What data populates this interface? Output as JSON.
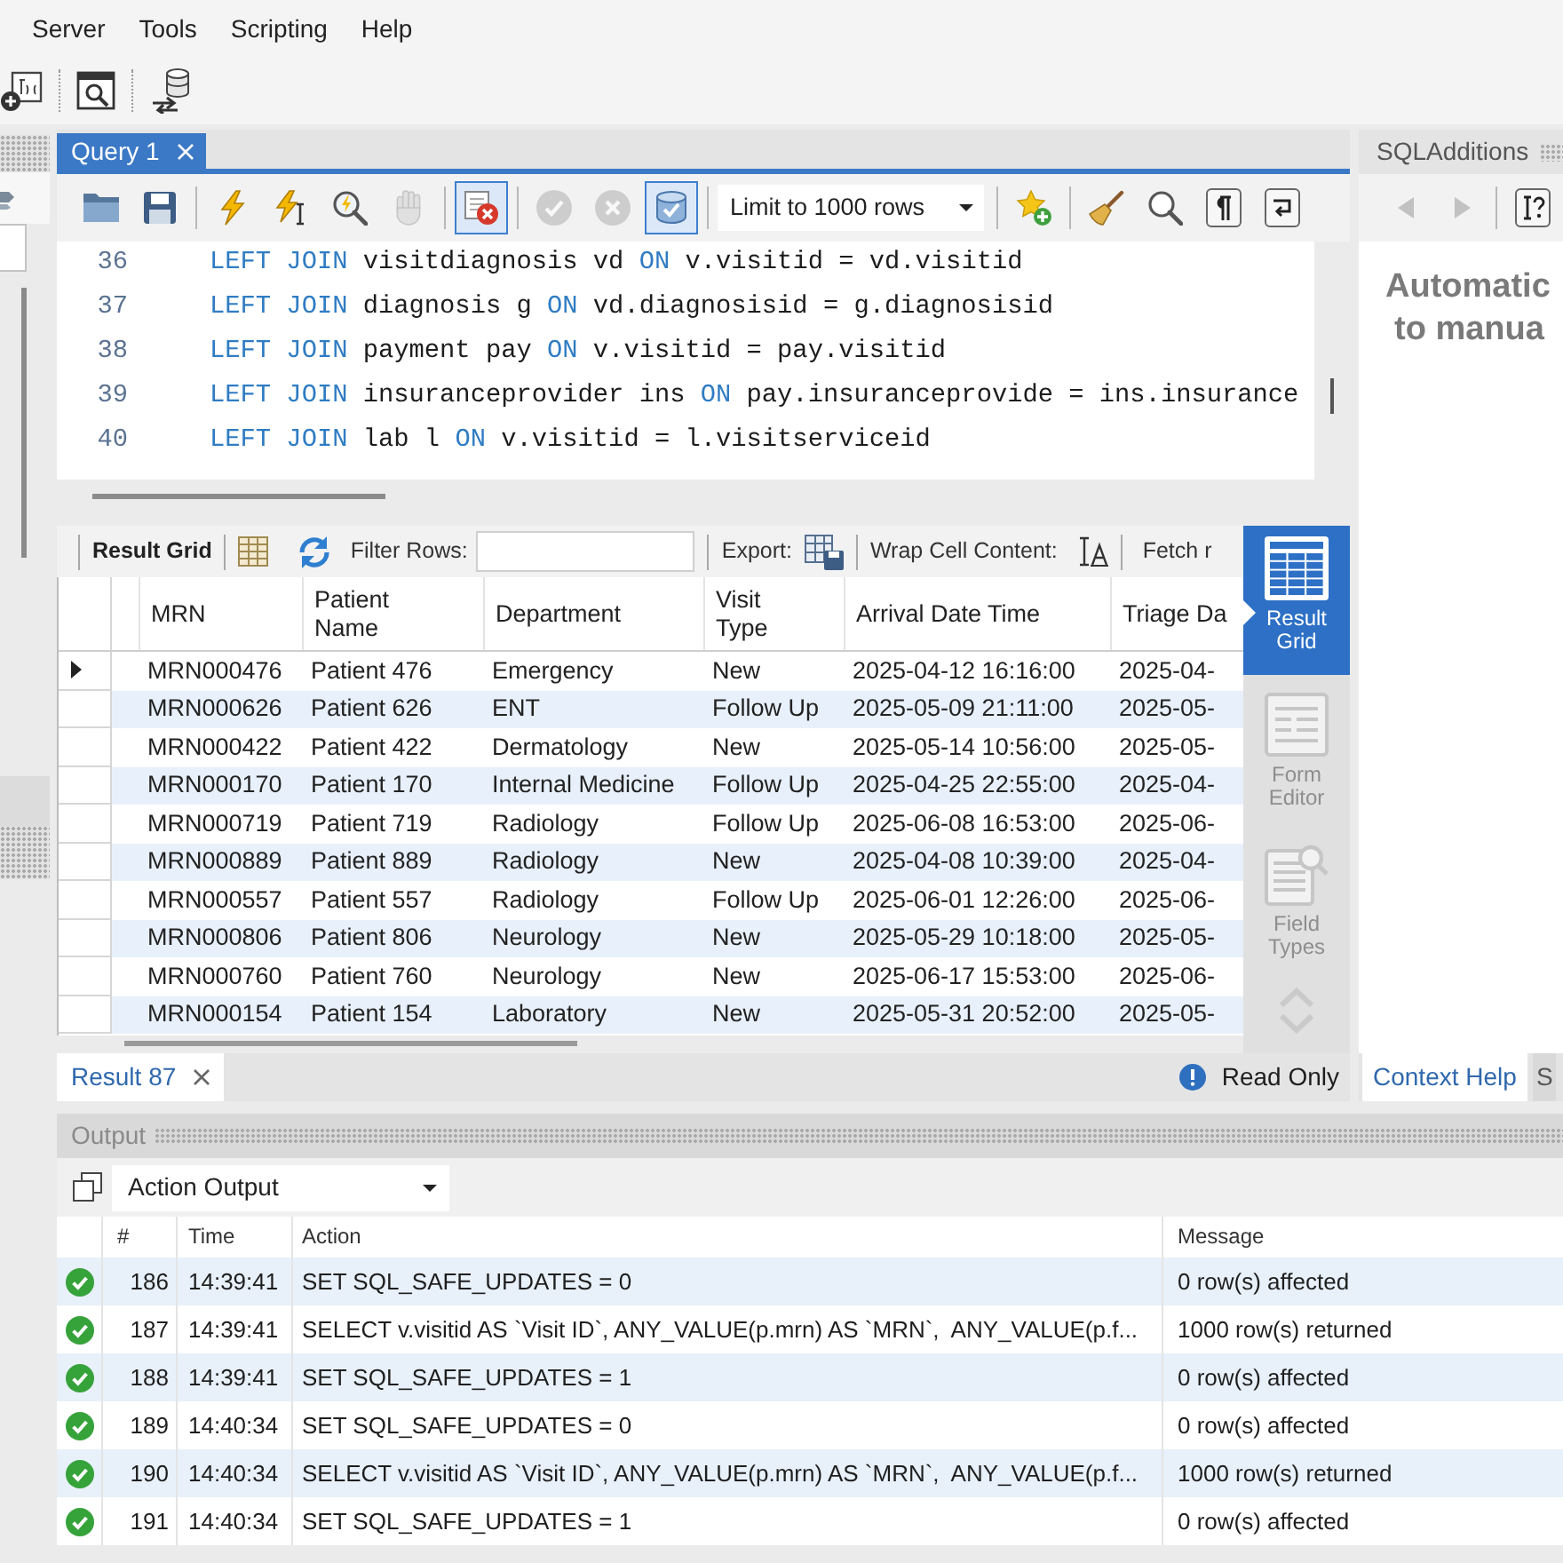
{
  "menu": [
    {
      "label": "Server"
    },
    {
      "label": "Tools"
    },
    {
      "label": "Scripting"
    },
    {
      "label": "Help"
    }
  ],
  "query_tabs": [
    {
      "label": "Query 1",
      "selected": true
    }
  ],
  "query_toolbar": {
    "groups_before": [
      [
        {
          "kind": "open",
          "pressed": false,
          "disabled": false
        },
        {
          "kind": "save",
          "pressed": false,
          "disabled": false
        }
      ],
      [
        {
          "kind": "execute",
          "pressed": false,
          "disabled": false
        },
        {
          "kind": "execute_current",
          "pressed": false,
          "disabled": false
        },
        {
          "kind": "explain",
          "pressed": false,
          "disabled": false
        },
        {
          "kind": "stop",
          "pressed": false,
          "disabled": true
        }
      ],
      [
        {
          "kind": "stop_on_error",
          "pressed": true,
          "disabled": false
        }
      ],
      [
        {
          "kind": "commit",
          "pressed": false,
          "disabled": true
        },
        {
          "kind": "rollback",
          "pressed": false,
          "disabled": true
        },
        {
          "kind": "autocommit",
          "pressed": true,
          "disabled": false
        }
      ]
    ],
    "limit": "Limit to 1000 rows",
    "groups_after": [
      [
        {
          "kind": "add_snippet",
          "pressed": false,
          "disabled": false
        }
      ],
      [
        {
          "kind": "beautify",
          "pressed": false,
          "disabled": false
        },
        {
          "kind": "find",
          "pressed": false,
          "disabled": false
        },
        {
          "kind": "invisibles",
          "pressed": false,
          "disabled": false
        },
        {
          "kind": "wrap",
          "pressed": false,
          "disabled": false
        }
      ]
    ]
  },
  "editor": {
    "lines": [
      {
        "number": "36",
        "tokens": [
          {
            "kind": "keyword",
            "text": "LEFT JOIN"
          },
          {
            "kind": "plain",
            "text": " visitdiagnosis vd "
          },
          {
            "kind": "keyword",
            "text": "ON"
          },
          {
            "kind": "plain",
            "text": " v.visitid = vd.visitid"
          }
        ]
      },
      {
        "number": "37",
        "tokens": [
          {
            "kind": "keyword",
            "text": "LEFT JOIN"
          },
          {
            "kind": "plain",
            "text": " diagnosis g "
          },
          {
            "kind": "keyword",
            "text": "ON"
          },
          {
            "kind": "plain",
            "text": " vd.diagnosisid = g.diagnosisid"
          }
        ]
      },
      {
        "number": "38",
        "tokens": [
          {
            "kind": "keyword",
            "text": "LEFT JOIN"
          },
          {
            "kind": "plain",
            "text": " payment pay "
          },
          {
            "kind": "keyword",
            "text": "ON"
          },
          {
            "kind": "plain",
            "text": " v.visitid = pay.visitid"
          }
        ]
      },
      {
        "number": "39",
        "tokens": [
          {
            "kind": "keyword",
            "text": "LEFT JOIN"
          },
          {
            "kind": "plain",
            "text": " insuranceprovider ins "
          },
          {
            "kind": "keyword",
            "text": "ON"
          },
          {
            "kind": "plain",
            "text": " pay.insuranceprovide = ins.insurance"
          }
        ]
      },
      {
        "number": "40",
        "tokens": [
          {
            "kind": "keyword",
            "text": "LEFT JOIN"
          },
          {
            "kind": "plain",
            "text": " lab l "
          },
          {
            "kind": "keyword",
            "text": "ON"
          },
          {
            "kind": "plain",
            "text": " v.visitid = l.visitserviceid"
          }
        ]
      }
    ]
  },
  "result_toolbar": {
    "title": "Result Grid",
    "filter_label": "Filter Rows:",
    "export_label": "Export:",
    "wrap_label": "Wrap Cell Content:",
    "fetch_label": "Fetch r"
  },
  "result_grid": {
    "columns": [
      "MRN",
      "Patient Name",
      "Department",
      "Visit Type",
      "Arrival Date Time",
      "Triage Da"
    ],
    "rows": [
      {
        "current": true,
        "cells": [
          "MRN000476",
          "Patient 476",
          "Emergency",
          "New",
          "2025-04-12 16:16:00",
          "2025-04-"
        ]
      },
      {
        "current": false,
        "cells": [
          "MRN000626",
          "Patient 626",
          "ENT",
          "Follow Up",
          "2025-05-09 21:11:00",
          "2025-05-"
        ]
      },
      {
        "current": false,
        "cells": [
          "MRN000422",
          "Patient 422",
          "Dermatology",
          "New",
          "2025-05-14 10:56:00",
          "2025-05-"
        ]
      },
      {
        "current": false,
        "cells": [
          "MRN000170",
          "Patient 170",
          "Internal Medicine",
          "Follow Up",
          "2025-04-25 22:55:00",
          "2025-04-"
        ]
      },
      {
        "current": false,
        "cells": [
          "MRN000719",
          "Patient 719",
          "Radiology",
          "Follow Up",
          "2025-06-08 16:53:00",
          "2025-06-"
        ]
      },
      {
        "current": false,
        "cells": [
          "MRN000889",
          "Patient 889",
          "Radiology",
          "New",
          "2025-04-08 10:39:00",
          "2025-04-"
        ]
      },
      {
        "current": false,
        "cells": [
          "MRN000557",
          "Patient 557",
          "Radiology",
          "Follow Up",
          "2025-06-01 12:26:00",
          "2025-06-"
        ]
      },
      {
        "current": false,
        "cells": [
          "MRN000806",
          "Patient 806",
          "Neurology",
          "New",
          "2025-05-29 10:18:00",
          "2025-05-"
        ]
      },
      {
        "current": false,
        "cells": [
          "MRN000760",
          "Patient 760",
          "Neurology",
          "New",
          "2025-06-17 15:53:00",
          "2025-06-"
        ]
      },
      {
        "current": false,
        "cells": [
          "MRN000154",
          "Patient 154",
          "Laboratory",
          "New",
          "2025-05-31 20:52:00",
          "2025-05-"
        ]
      }
    ]
  },
  "result_views": [
    {
      "kind": "grid",
      "label": "Result Grid",
      "selected": true
    },
    {
      "kind": "form",
      "label": "Form Editor",
      "selected": false
    },
    {
      "kind": "fields",
      "label": "Field Types",
      "selected": false
    }
  ],
  "result_tabs": [
    {
      "label": "Result 87",
      "selected": true
    }
  ],
  "read_only": "Read Only",
  "sql_additions": {
    "title": "SQLAdditions",
    "button_groups": [
      [
        {
          "kind": "back",
          "disabled": true
        },
        {
          "kind": "forward",
          "disabled": true
        }
      ],
      [
        {
          "kind": "help",
          "disabled": false
        }
      ]
    ],
    "help_lines": [
      "Automatic",
      "to manua"
    ],
    "tabs": [
      {
        "label": "Context Help",
        "selected": true
      },
      {
        "label": "S",
        "selected": false
      }
    ]
  },
  "output": {
    "title": "Output",
    "view": "Action Output",
    "columns": [
      "#",
      "Time",
      "Action",
      "Message"
    ],
    "rows": [
      {
        "success": true,
        "number": "186",
        "time": "14:39:41",
        "action": "SET SQL_SAFE_UPDATES = 0",
        "message": "0 row(s) affected"
      },
      {
        "success": true,
        "number": "187",
        "time": "14:39:41",
        "action": "SELECT v.visitid AS `Visit ID`, ANY_VALUE(p.mrn) AS `MRN`,  ANY_VALUE(p.f...",
        "message": "1000 row(s) returned"
      },
      {
        "success": true,
        "number": "188",
        "time": "14:39:41",
        "action": "SET SQL_SAFE_UPDATES = 1",
        "message": "0 row(s) affected"
      },
      {
        "success": true,
        "number": "189",
        "time": "14:40:34",
        "action": "SET SQL_SAFE_UPDATES = 0",
        "message": "0 row(s) affected"
      },
      {
        "success": true,
        "number": "190",
        "time": "14:40:34",
        "action": "SELECT v.visitid AS `Visit ID`, ANY_VALUE(p.mrn) AS `MRN`,  ANY_VALUE(p.f...",
        "message": "1000 row(s) returned"
      },
      {
        "success": true,
        "number": "191",
        "time": "14:40:34",
        "action": "SET SQL_SAFE_UPDATES = 1",
        "message": "0 row(s) affected"
      }
    ]
  }
}
